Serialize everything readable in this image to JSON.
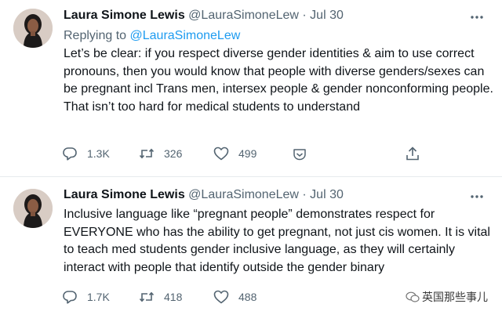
{
  "tweets": [
    {
      "display_name": "Laura Simone Lewis",
      "handle": "@LauraSimoneLew",
      "separator": "·",
      "date": "Jul 30",
      "reply_prefix": "Replying to ",
      "reply_mention": "@LauraSimoneLew",
      "text": "Let’s be clear: if you respect diverse gender identities & aim to use correct pronouns, then you would know that people with diverse genders/sexes can be pregnant incl Trans men, intersex people & gender nonconforming people. That isn’t too hard for medical students to understand",
      "reply_count": "1.3K",
      "retweet_count": "326",
      "like_count": "499"
    },
    {
      "display_name": "Laura Simone Lewis",
      "handle": "@LauraSimoneLew",
      "separator": "·",
      "date": "Jul 30",
      "text": "Inclusive language like “pregnant people” demonstrates respect for EVERYONE who has the ability to get pregnant, not just cis women. It is vital to teach med students gender inclusive language, as they will certainly interact with people that identify outside the gender binary",
      "reply_count": "1.7K",
      "retweet_count": "418",
      "like_count": "488"
    }
  ],
  "watermark": "英国那些事儿",
  "icons": {
    "reply": "reply-icon",
    "retweet": "retweet-icon",
    "like": "heart-icon",
    "react": "reaction-icon",
    "share": "share-icon",
    "more": "more-icon"
  },
  "colors": {
    "text": "#0f1419",
    "secondary": "#536471",
    "link": "#1d9bf0",
    "divider": "#e7ebee"
  }
}
